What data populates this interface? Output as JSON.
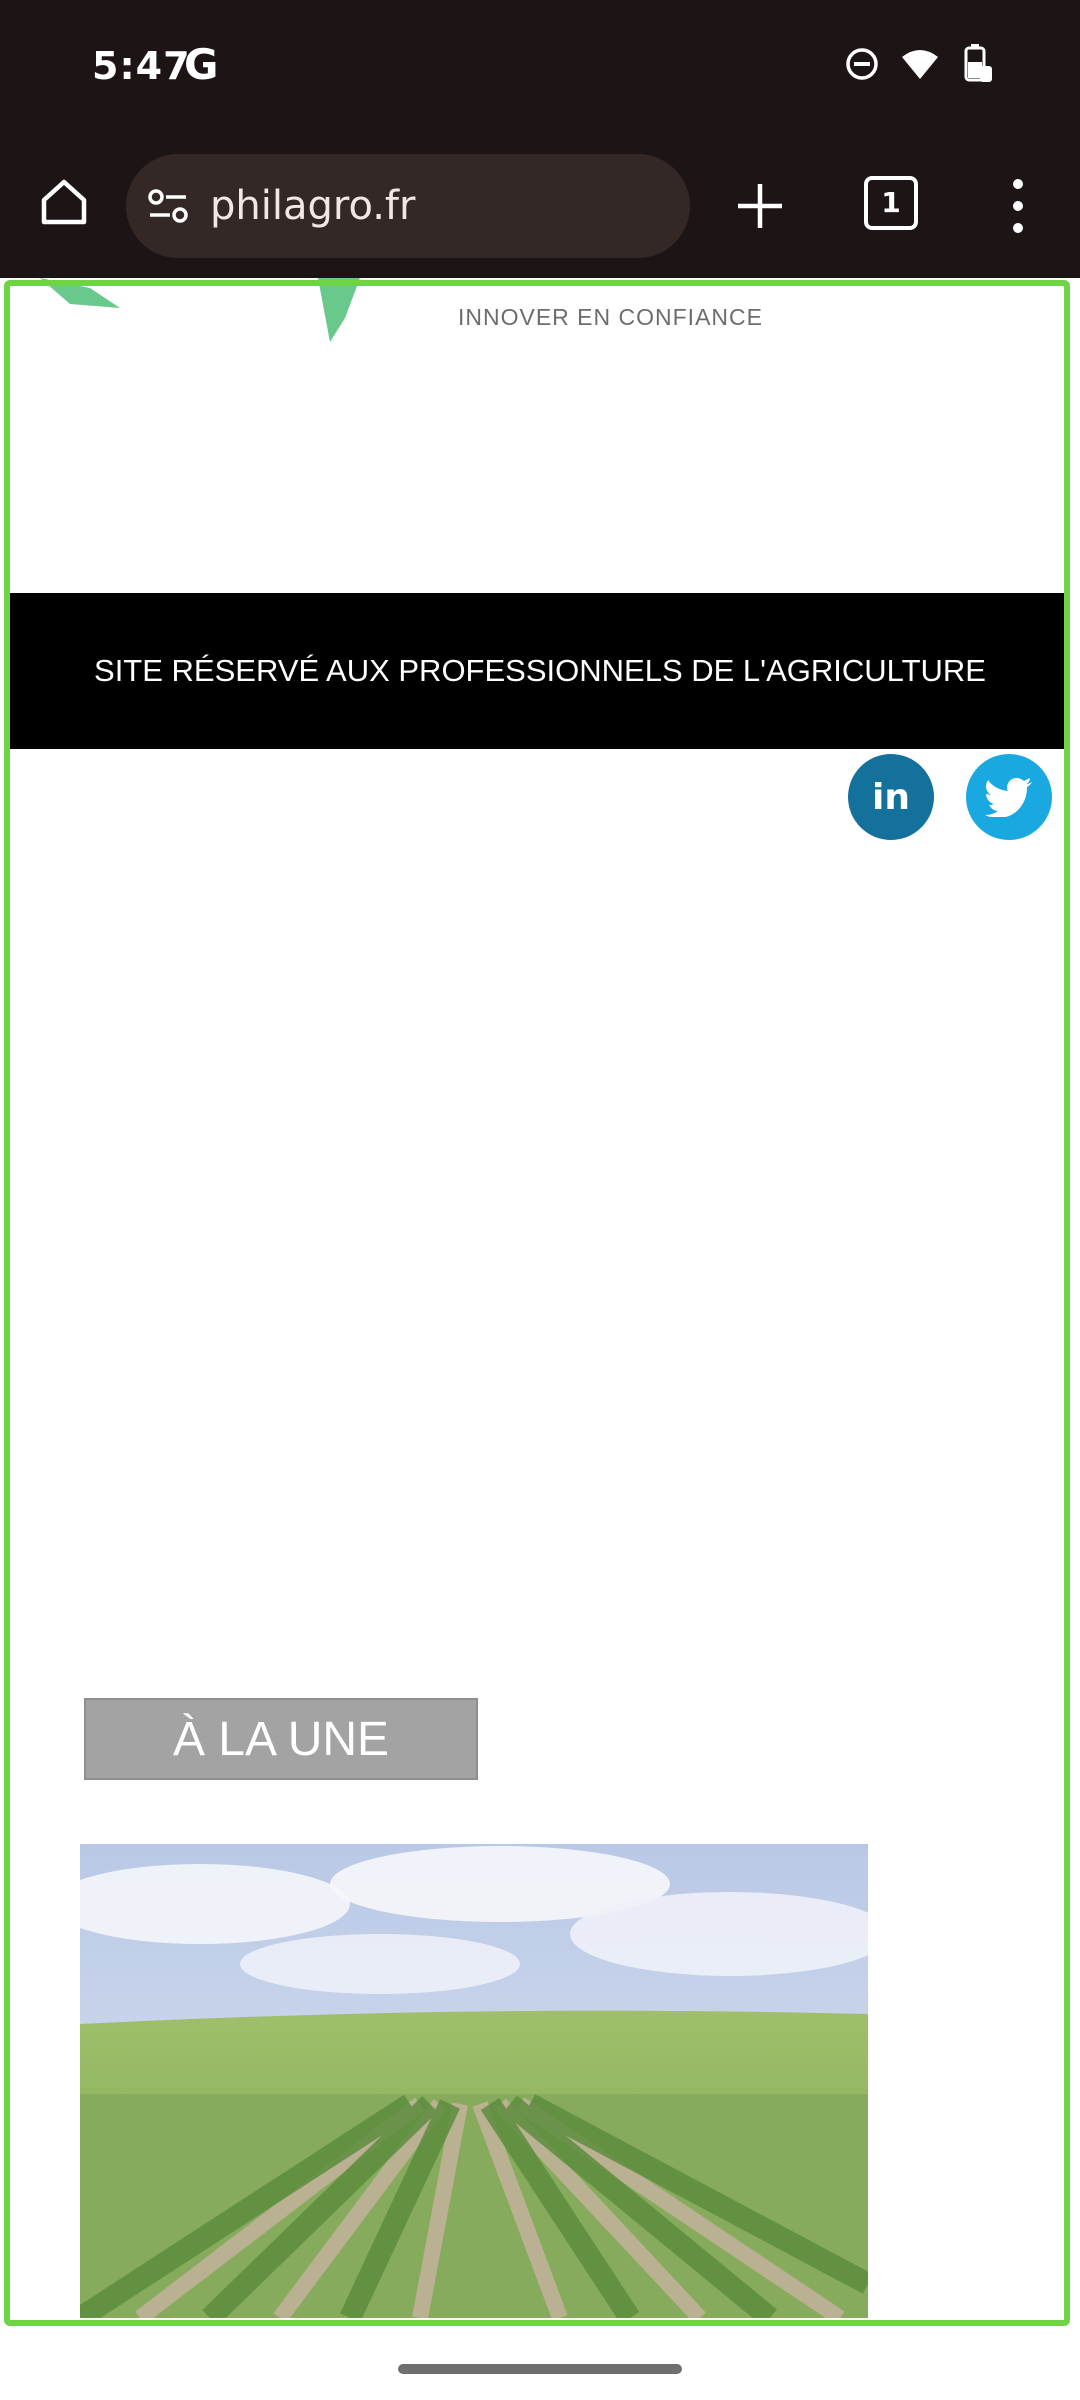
{
  "status_bar": {
    "time": "5:47",
    "google_glyph": "G",
    "icons": [
      "do-not-disturb-icon",
      "wifi-icon",
      "battery-icon"
    ]
  },
  "browser": {
    "url": "philagro.fr",
    "tab_count": "1",
    "icons": [
      "home-icon",
      "site-settings-icon",
      "plus-icon",
      "tabs-icon",
      "more-vert-icon"
    ]
  },
  "page": {
    "tagline": "INNOVER EN CONFIANCE",
    "notice": "SITE RÉSERVÉ AUX PROFESSIONNELS DE L'AGRICULTURE",
    "social": {
      "linkedin_label": "in",
      "linkedin_color": "#13719c",
      "twitter_color": "#1aa8e1"
    },
    "section_badge": "À LA UNE",
    "colors": {
      "accent_frame": "#6fd346",
      "notice_bg": "#000000",
      "badge_bg": "#a3a3a3"
    }
  }
}
